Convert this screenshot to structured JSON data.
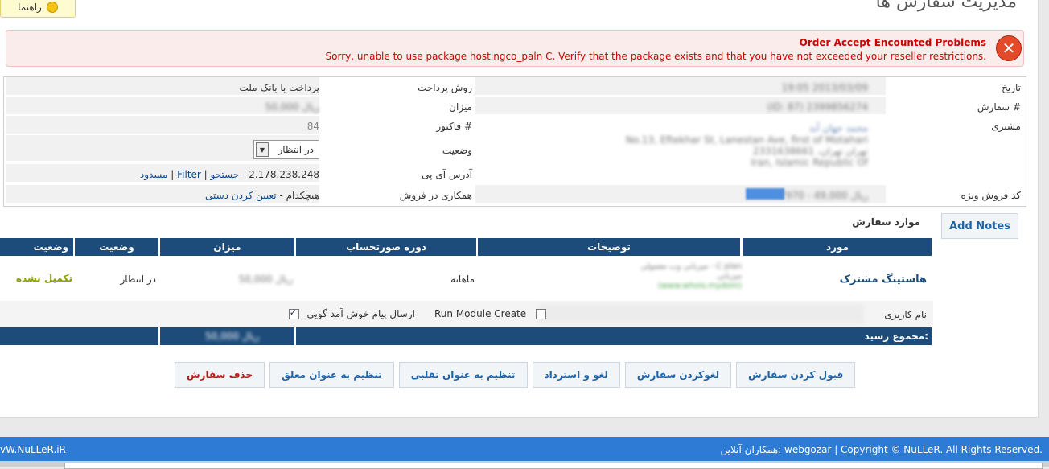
{
  "header": {
    "title": "مدیریت سفارش ها",
    "help_label": "راهنما"
  },
  "error": {
    "title": "Order Accept Encounted Problems",
    "message": "Sorry, unable to use package hostingco_paln C. Verify that the package exists and that you have not exceeded your reseller restrictions."
  },
  "order_info": {
    "date_label": "تاریخ",
    "date_value": "19:05 2013/03/09",
    "order_label": "سفارش #",
    "order_value": "(ID: 87) 2399856274",
    "client_label": "مشتری",
    "client_name": "محمد جهان آبد",
    "client_address": [
      "No.13, Eftekhar St, Lanestan Ave, first of Motahari",
      "تهران تهران، 2331638661",
      "Iran, Islamic Republic Of"
    ],
    "promo_label": "کد فروش ویژه",
    "promo_value": "7970 - 49,000 ریال",
    "payment_method_label": "روش پرداخت",
    "payment_method_value": "پرداخت با بانک ملت",
    "amount_label": "میزان",
    "amount_value": "50,000 ریال",
    "invoice_label": "فاکتور #",
    "invoice_value": "84",
    "status_label": "وضعیت",
    "status_value": "در انتظار",
    "ip_label": "آدرس آی پی",
    "ip_value": "2.178.238.248 - ",
    "ip_search": "جستجو",
    "ip_filter": "Filter",
    "ip_block": "مسدود",
    "affiliate_label": "همکاری در فروش",
    "affiliate_value": "هیچکدام - ",
    "affiliate_assign": "تعیین کردن دستی"
  },
  "notes_button": "Add Notes",
  "items": {
    "title": "موارد سفارش",
    "columns": [
      "مورد",
      "توضیحات",
      "دوره صورتحساب",
      "میزان",
      "وضعیت",
      "وضعیت"
    ],
    "row": {
      "item": "هاستینگ مشترک",
      "description_lines": [
        "میزبانی وب معمولی - C plan",
        "میزبانی",
        "(www.whois.mydom)"
      ],
      "cycle": "ماهانه",
      "amount": "50,000 ریال",
      "status": "در انتظار",
      "payment_status": "تکمیل نشده"
    },
    "sub": {
      "username_label": "نام کاربری",
      "run_module_label": "Run Module Create",
      "welcome_label": "ارسال پیام خوش آمد گویی"
    },
    "total_label": "مجموع رسید:",
    "total_value": "50,000 ریال"
  },
  "actions": {
    "accept": "قبول کردن سفارش",
    "cancel": "لغوکردن سفارش",
    "refund": "لغو و استرداد",
    "fraud": "تنظیم به عنوان تقلبی",
    "pending": "تنظیم به عنوان معلق",
    "delete": "حذف سفارش"
  },
  "footer": {
    "copyright": "Copyright © NuLLeR. All Rights Reserved.",
    "partners": "همکاران آنلاین: webgozar",
    "site": "vW.NuLLeR.iR"
  },
  "colors": {
    "header_blue": "#1e4c7a",
    "error_red": "#cc0000",
    "footer_blue": "#2d7bd4",
    "success_olive": "#8ca000"
  }
}
